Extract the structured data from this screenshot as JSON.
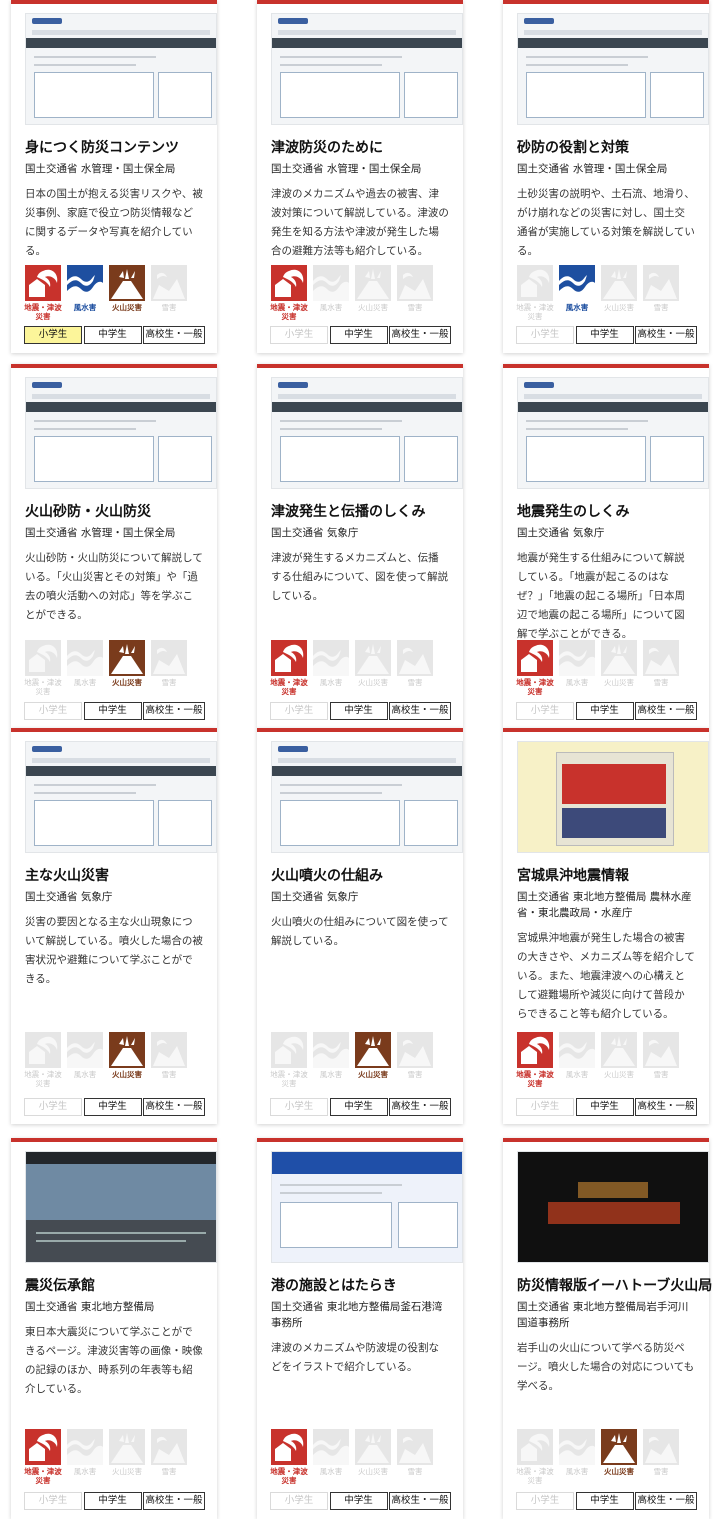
{
  "hazard_labels": {
    "quake": "地震・津波\n災害",
    "wind": "風水害",
    "volc": "火山災害",
    "snow": "雪害"
  },
  "level_labels": {
    "elementary": "小学生",
    "junior": "中学生",
    "high": "高校生・一般"
  },
  "colors": {
    "accent_red": "#c8322c",
    "wind_blue": "#1e4fa0",
    "volcano_brown": "#7a3b1c",
    "highlight_yellow": "#fcf59a"
  },
  "icons": {
    "quake": "earthquake-tsunami-icon",
    "wind": "storm-flood-icon",
    "volc": "volcano-icon",
    "snow": "snow-icon"
  },
  "cards": [
    {
      "title": "身につく防災コンテンツ",
      "agency": "国土交通省 水管理・国土保全局",
      "description": "日本の国土が抱える災害リスクや、被災事例、家庭で役立つ防災情報などに関するデータや写真を紹介している。",
      "hazards": {
        "quake": true,
        "wind": true,
        "volc": true,
        "snow": false
      },
      "levels": {
        "elementary": "highlight",
        "junior": "on",
        "high": "on"
      }
    },
    {
      "title": "津波防災のために",
      "agency": "国土交通省 水管理・国土保全局",
      "description": "津波のメカニズムや過去の被害、津波対策について解説している。津波の発生を知る方法や津波が発生した場合の避難方法等も紹介している。",
      "hazards": {
        "quake": true,
        "wind": false,
        "volc": false,
        "snow": false
      },
      "levels": {
        "elementary": "off",
        "junior": "on",
        "high": "on"
      }
    },
    {
      "title": "砂防の役割と対策",
      "agency": "国土交通省 水管理・国土保全局",
      "description": "土砂災害の説明や、土石流、地滑り、がけ崩れなどの災害に対し、国土交通省が実施している対策を解説している。",
      "hazards": {
        "quake": false,
        "wind": true,
        "volc": false,
        "snow": false
      },
      "levels": {
        "elementary": "off",
        "junior": "on",
        "high": "on"
      }
    },
    {
      "title": "火山砂防・火山防災",
      "agency": "国土交通省 水管理・国土保全局",
      "description": "火山砂防・火山防災について解説している。「火山災害とその対策」や「過去の噴火活動への対応」等を学ぶことができる。",
      "hazards": {
        "quake": false,
        "wind": false,
        "volc": true,
        "snow": false
      },
      "levels": {
        "elementary": "off",
        "junior": "on",
        "high": "on"
      }
    },
    {
      "title": "津波発生と伝播のしくみ",
      "agency": "国土交通省 気象庁",
      "description": "津波が発生するメカニズムと、伝播する仕組みについて、図を使って解説している。",
      "hazards": {
        "quake": true,
        "wind": false,
        "volc": false,
        "snow": false
      },
      "levels": {
        "elementary": "off",
        "junior": "on",
        "high": "on"
      }
    },
    {
      "title": "地震発生のしくみ",
      "agency": "国土交通省 気象庁",
      "description": "地震が発生する仕組みについて解説している。「地震が起こるのはなぜ？」「地震の起こる場所」「日本周辺で地震の起こる場所」について図解で学ぶことができる。",
      "hazards": {
        "quake": true,
        "wind": false,
        "volc": false,
        "snow": false
      },
      "levels": {
        "elementary": "off",
        "junior": "on",
        "high": "on"
      }
    },
    {
      "title": "主な火山災害",
      "agency": "国土交通省 気象庁",
      "description": "災害の要因となる主な火山現象について解説している。噴火した場合の被害状況や避難について学ぶことができる。",
      "hazards": {
        "quake": false,
        "wind": false,
        "volc": true,
        "snow": false
      },
      "levels": {
        "elementary": "off",
        "junior": "on",
        "high": "on"
      }
    },
    {
      "title": "火山噴火の仕組み",
      "agency": "国土交通省 気象庁",
      "description": "火山噴火の仕組みについて図を使って解説している。",
      "hazards": {
        "quake": false,
        "wind": false,
        "volc": true,
        "snow": false
      },
      "levels": {
        "elementary": "off",
        "junior": "on",
        "high": "on"
      }
    },
    {
      "title": "宮城県沖地震情報",
      "agency": "国土交通省 東北地方整備局 農林水産省・東北農政局・水産庁",
      "description": "宮城県沖地震が発生した場合の被害の大きさや、メカニズム等を紹介している。また、地震津波への心構えとして避難場所や減災に向けて普段からできること等も紹介している。",
      "hazards": {
        "quake": true,
        "wind": false,
        "volc": false,
        "snow": false
      },
      "levels": {
        "elementary": "off",
        "junior": "on",
        "high": "on"
      }
    },
    {
      "title": "震災伝承館",
      "agency": "国土交通省 東北地方整備局",
      "description": "東日本大震災について学ぶことができるページ。津波災害等の画像・映像の記録のほか、時系列の年表等も紹介している。",
      "hazards": {
        "quake": true,
        "wind": false,
        "volc": false,
        "snow": false
      },
      "levels": {
        "elementary": "off",
        "junior": "on",
        "high": "on"
      }
    },
    {
      "title": "港の施設とはたらき",
      "agency": "国土交通省 東北地方整備局釜石港湾事務所",
      "description": "津波のメカニズムや防波堤の役割などをイラストで紹介している。",
      "hazards": {
        "quake": true,
        "wind": false,
        "volc": false,
        "snow": false
      },
      "levels": {
        "elementary": "off",
        "junior": "on",
        "high": "on"
      }
    },
    {
      "title": "防災情報版イーハトーブ火山局",
      "agency": "国土交通省 東北地方整備局岩手河川国道事務所",
      "description": "岩手山の火山について学べる防災ページ。噴火した場合の対応についても学べる。",
      "hazards": {
        "quake": false,
        "wind": false,
        "volc": true,
        "snow": false
      },
      "levels": {
        "elementary": "off",
        "junior": "on",
        "high": "on"
      }
    }
  ]
}
